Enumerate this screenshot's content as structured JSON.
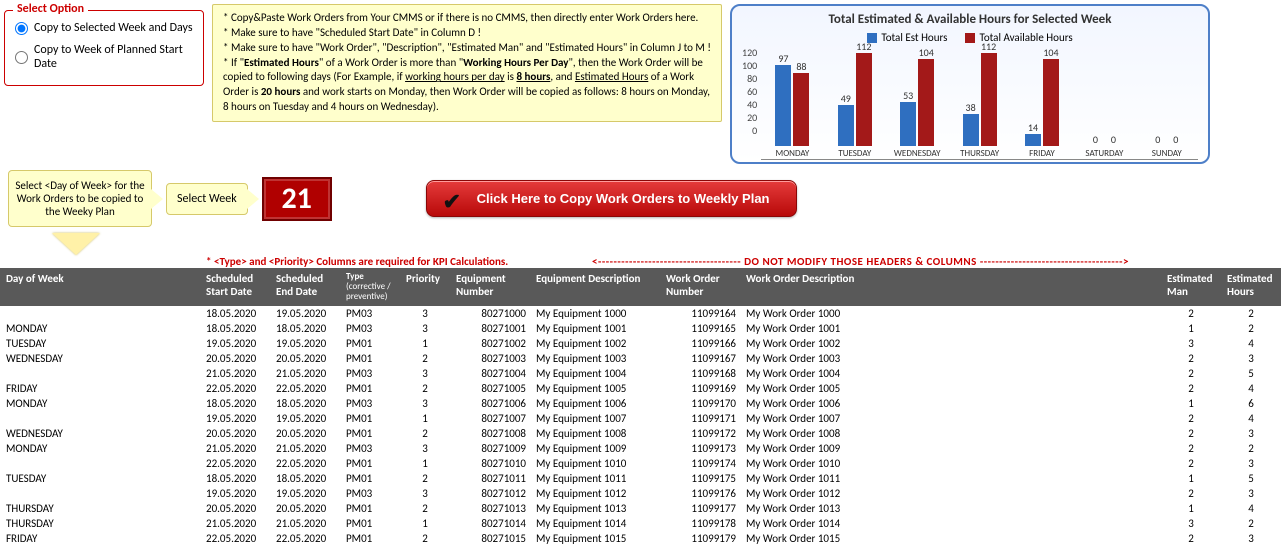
{
  "options": {
    "title": "Select Option",
    "opt1": "Copy to Selected Week and Days",
    "opt2": "Copy to Week of Planned Start Date"
  },
  "info": {
    "l1": "* Copy&Paste Work Orders from Your CMMS or if there is no CMMS, then directly enter Work Orders here.",
    "l2": "* Make sure to have \"Scheduled Start Date\" in Column D !",
    "l3": "* Make sure to have \"Work Order\", \"Description\", \"Estimated Man\" and \"Estimated Hours\" in Column J to M !",
    "l4a": "* If \"",
    "l4b": "Estimated Hours",
    "l4c": "\" of a Work Order is more than \"",
    "l4d": "Working Hours Per Day",
    "l4e": "\", then the Work Order will be copied to following days (For Example, if ",
    "l4f": "working hours per day",
    "l4g": " is ",
    "l4h": "8 hours",
    "l4i": ", and ",
    "l4j": "Estimated Hours",
    "l4k": " of a Work Order is ",
    "l4l": "20 hours",
    "l4m": " and work starts on Monday, then Work Order will be copied as follows: 8 hours on Monday, 8 hours on Tuesday and 4 hours on Wednesday)."
  },
  "select_day_hint": "Select <Day of Week> for the Work Orders to be copied to the Weeky Plan",
  "select_week_label": "Select Week",
  "week_number": "21",
  "copy_button": "Click Here to Copy Work Orders to Weekly Plan",
  "notice_left": "* <Type> and <Priority> Columns are required for KPI Calculations.",
  "notice_right": "DO NOT MODIFY THOSE HEADERS & COLUMNS",
  "headers": {
    "day": "Day of Week",
    "sd": "Scheduled Start Date",
    "ed": "Scheduled End Date",
    "type": "Type",
    "type_sub": "(corrective / preventive)",
    "pri": "Priority",
    "eqn": "Equipment Number",
    "eqd": "Equipment Description",
    "won": "Work Order Number",
    "wod": "Work Order Description",
    "em": "Estimated Man",
    "eh": "Estimated Hours"
  },
  "chart_data": {
    "type": "bar",
    "title": "Total Estimated & Available Hours for Selected Week",
    "legend": [
      "Total Est Hours",
      "Total Available Hours"
    ],
    "colors": [
      "#2f6fc0",
      "#a31919"
    ],
    "categories": [
      "MONDAY",
      "TUESDAY",
      "WEDNESDAY",
      "THURSDAY",
      "FRIDAY",
      "SATURDAY",
      "SUNDAY"
    ],
    "series": [
      {
        "name": "Total Est Hours",
        "values": [
          97,
          49,
          53,
          38,
          14,
          0,
          0
        ]
      },
      {
        "name": "Total Available Hours",
        "values": [
          88,
          112,
          104,
          112,
          104,
          0,
          0
        ]
      }
    ],
    "ylim": [
      0,
      120
    ],
    "yticks": [
      0,
      20,
      40,
      60,
      80,
      100,
      120
    ]
  },
  "rows": [
    {
      "day": "",
      "sd": "18.05.2020",
      "ed": "19.05.2020",
      "type": "PM03",
      "pri": "3",
      "eqn": "80271000",
      "eqd": "My Equipment 1000",
      "won": "11099164",
      "wod": "My Work Order 1000",
      "em": "2",
      "eh": "2"
    },
    {
      "day": "MONDAY",
      "sd": "18.05.2020",
      "ed": "18.05.2020",
      "type": "PM03",
      "pri": "3",
      "eqn": "80271001",
      "eqd": "My Equipment 1001",
      "won": "11099165",
      "wod": "My Work Order 1001",
      "em": "1",
      "eh": "2"
    },
    {
      "day": "TUESDAY",
      "sd": "19.05.2020",
      "ed": "19.05.2020",
      "type": "PM01",
      "pri": "1",
      "eqn": "80271002",
      "eqd": "My Equipment 1002",
      "won": "11099166",
      "wod": "My Work Order 1002",
      "em": "3",
      "eh": "4"
    },
    {
      "day": "WEDNESDAY",
      "sd": "20.05.2020",
      "ed": "20.05.2020",
      "type": "PM01",
      "pri": "2",
      "eqn": "80271003",
      "eqd": "My Equipment 1003",
      "won": "11099167",
      "wod": "My Work Order 1003",
      "em": "2",
      "eh": "3"
    },
    {
      "day": "",
      "sd": "21.05.2020",
      "ed": "21.05.2020",
      "type": "PM03",
      "pri": "3",
      "eqn": "80271004",
      "eqd": "My Equipment 1004",
      "won": "11099168",
      "wod": "My Work Order 1004",
      "em": "2",
      "eh": "5"
    },
    {
      "day": "FRIDAY",
      "sd": "22.05.2020",
      "ed": "22.05.2020",
      "type": "PM01",
      "pri": "2",
      "eqn": "80271005",
      "eqd": "My Equipment 1005",
      "won": "11099169",
      "wod": "My Work Order 1005",
      "em": "2",
      "eh": "4"
    },
    {
      "day": "MONDAY",
      "sd": "18.05.2020",
      "ed": "18.05.2020",
      "type": "PM03",
      "pri": "3",
      "eqn": "80271006",
      "eqd": "My Equipment 1006",
      "won": "11099170",
      "wod": "My Work Order 1006",
      "em": "1",
      "eh": "6"
    },
    {
      "day": "",
      "sd": "19.05.2020",
      "ed": "19.05.2020",
      "type": "PM01",
      "pri": "1",
      "eqn": "80271007",
      "eqd": "My Equipment 1007",
      "won": "11099171",
      "wod": "My Work Order 1007",
      "em": "2",
      "eh": "4"
    },
    {
      "day": "WEDNESDAY",
      "sd": "20.05.2020",
      "ed": "20.05.2020",
      "type": "PM01",
      "pri": "2",
      "eqn": "80271008",
      "eqd": "My Equipment 1008",
      "won": "11099172",
      "wod": "My Work Order 1008",
      "em": "2",
      "eh": "3"
    },
    {
      "day": "MONDAY",
      "sd": "21.05.2020",
      "ed": "21.05.2020",
      "type": "PM03",
      "pri": "3",
      "eqn": "80271009",
      "eqd": "My Equipment 1009",
      "won": "11099173",
      "wod": "My Work Order 1009",
      "em": "2",
      "eh": "2"
    },
    {
      "day": "",
      "sd": "22.05.2020",
      "ed": "22.05.2020",
      "type": "PM01",
      "pri": "1",
      "eqn": "80271010",
      "eqd": "My Equipment 1010",
      "won": "11099174",
      "wod": "My Work Order 1010",
      "em": "2",
      "eh": "3"
    },
    {
      "day": "TUESDAY",
      "sd": "18.05.2020",
      "ed": "18.05.2020",
      "type": "PM01",
      "pri": "2",
      "eqn": "80271011",
      "eqd": "My Equipment 1011",
      "won": "11099175",
      "wod": "My Work Order 1011",
      "em": "1",
      "eh": "5"
    },
    {
      "day": "",
      "sd": "19.05.2020",
      "ed": "19.05.2020",
      "type": "PM03",
      "pri": "3",
      "eqn": "80271012",
      "eqd": "My Equipment 1012",
      "won": "11099176",
      "wod": "My Work Order 1012",
      "em": "2",
      "eh": "3"
    },
    {
      "day": "THURSDAY",
      "sd": "20.05.2020",
      "ed": "20.05.2020",
      "type": "PM01",
      "pri": "2",
      "eqn": "80271013",
      "eqd": "My Equipment 1013",
      "won": "11099177",
      "wod": "My Work Order 1013",
      "em": "1",
      "eh": "4"
    },
    {
      "day": "THURSDAY",
      "sd": "21.05.2020",
      "ed": "21.05.2020",
      "type": "PM01",
      "pri": "1",
      "eqn": "80271014",
      "eqd": "My Equipment 1014",
      "won": "11099178",
      "wod": "My Work Order 1014",
      "em": "3",
      "eh": "2"
    },
    {
      "day": "FRIDAY",
      "sd": "22.05.2020",
      "ed": "22.05.2020",
      "type": "PM01",
      "pri": "2",
      "eqn": "80271015",
      "eqd": "My Equipment 1015",
      "won": "11099179",
      "wod": "My Work Order 1015",
      "em": "2",
      "eh": "3"
    }
  ]
}
